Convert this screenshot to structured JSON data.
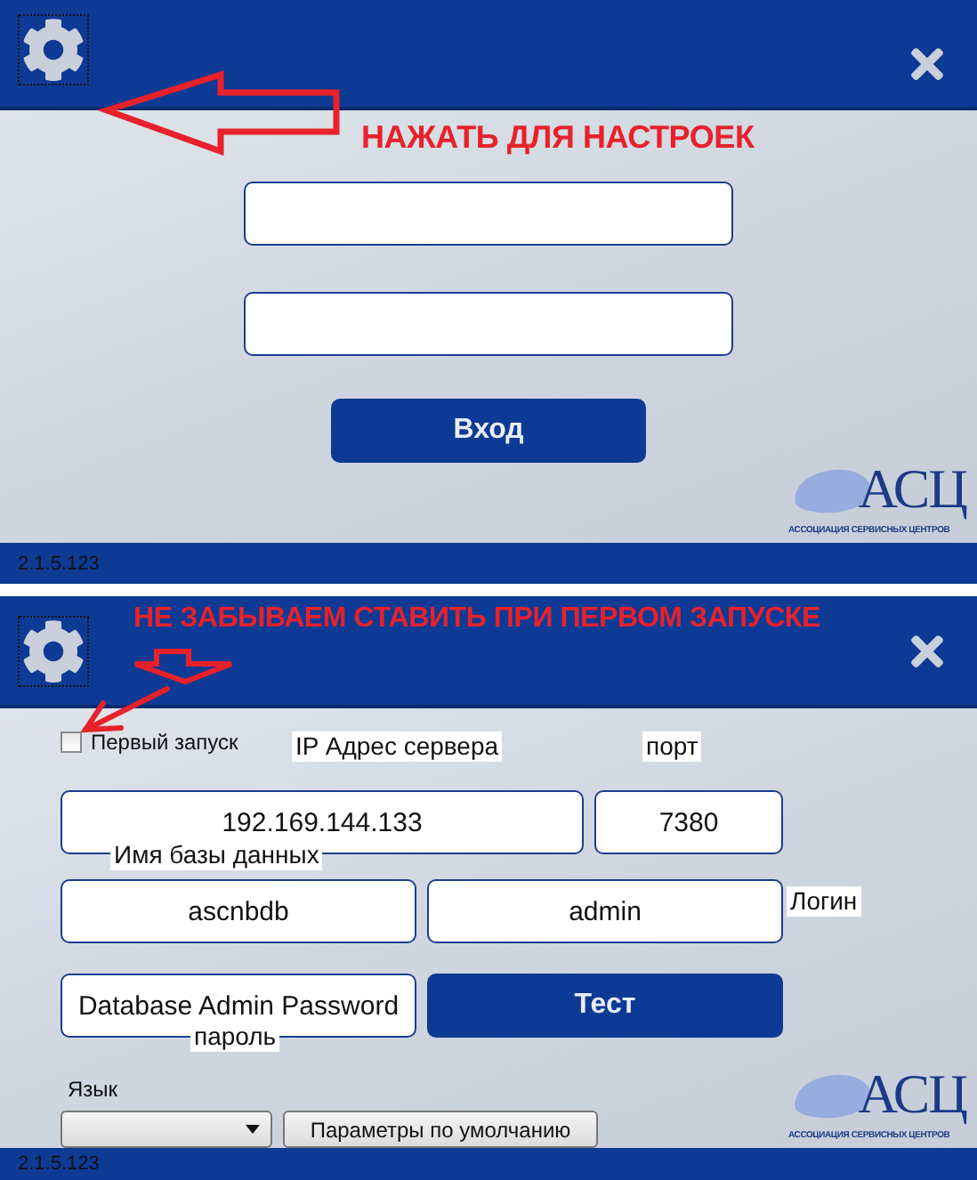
{
  "login_screen": {
    "annotation": "НАЖАТЬ ДЛЯ НАСТРОЕК",
    "login_button": "Вход",
    "logo": {
      "mark": "АСЦ",
      "caption": "АССОЦИАЦИЯ СЕРВИСНЫХ ЦЕНТРОВ"
    },
    "version": "2.1.5.123"
  },
  "settings_screen": {
    "annotation": "НЕ ЗАБЫВАЕМ СТАВИТЬ ПРИ ПЕРВОМ ЗАПУСКЕ",
    "first_run": {
      "label": "Первый запуск",
      "checked": false
    },
    "server_ip": {
      "note": "IP Адрес сервера",
      "value": "192.169.144.133"
    },
    "port": {
      "note": "порт",
      "value": "7380"
    },
    "database": {
      "note": "Имя базы данных",
      "value": "ascnbdb"
    },
    "login": {
      "note": "Логин",
      "value": "admin"
    },
    "password": {
      "note": "пароль",
      "value": "Database Admin Password"
    },
    "test_button": "Тест",
    "language_label": "Язык",
    "defaults_button": "Параметры по умолчанию",
    "logo": {
      "mark": "АСЦ",
      "caption": "АССОЦИАЦИЯ СЕРВИСНЫХ ЦЕНТРОВ"
    },
    "version": "2.1.5.123"
  }
}
